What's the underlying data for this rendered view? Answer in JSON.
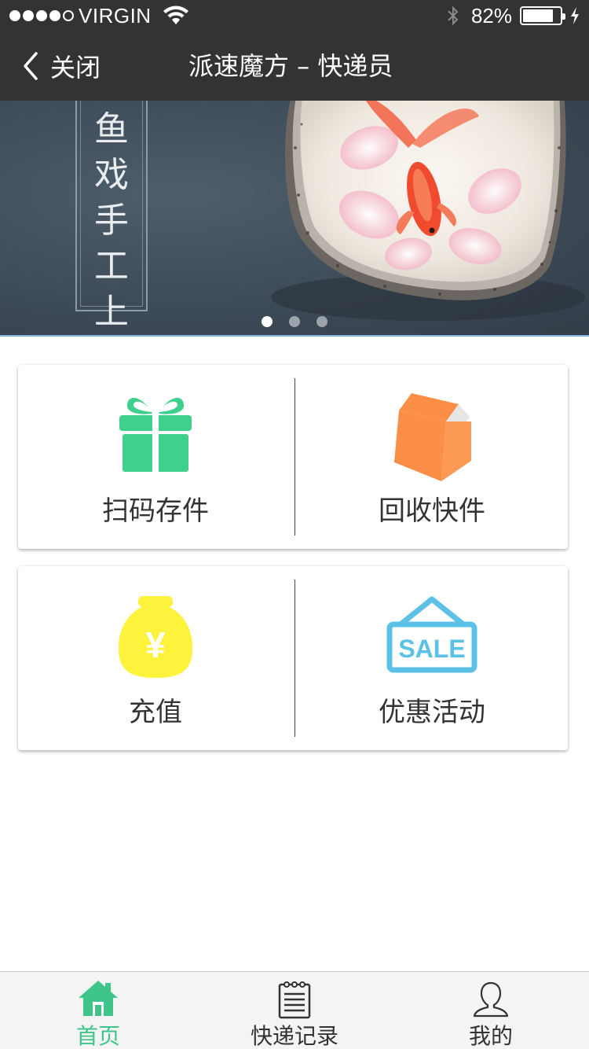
{
  "status_bar": {
    "carrier": "VIRGIN",
    "signal_bars": 4,
    "battery_percent": "82%",
    "battery_level": 0.82
  },
  "nav": {
    "back_label": "关闭",
    "title": "派速魔方 – 快递员"
  },
  "banner": {
    "text_chars": [
      "鱼",
      "戏",
      "手",
      "工",
      "上"
    ],
    "slide_count": 3,
    "active_slide": 0
  },
  "tiles": [
    {
      "label": "扫码存件",
      "icon": "gift-icon",
      "color": "#3fd08e"
    },
    {
      "label": "回收快件",
      "icon": "box-icon",
      "color": "#fb8f48"
    },
    {
      "label": "充值",
      "icon": "money-bag-icon",
      "color": "#fdf23c"
    },
    {
      "label": "优惠活动",
      "icon": "sale-sign-icon",
      "color": "#5bc1e6",
      "icon_text": "SALE"
    }
  ],
  "tab_bar": {
    "items": [
      {
        "label": "首页",
        "icon": "home-icon",
        "active": true
      },
      {
        "label": "快递记录",
        "icon": "notepad-icon",
        "active": false
      },
      {
        "label": "我的",
        "icon": "user-icon",
        "active": false
      }
    ],
    "active_color": "#3fc58a"
  },
  "colors": {
    "header_bg": "#333333",
    "banner_bg": "#3e4b58"
  }
}
